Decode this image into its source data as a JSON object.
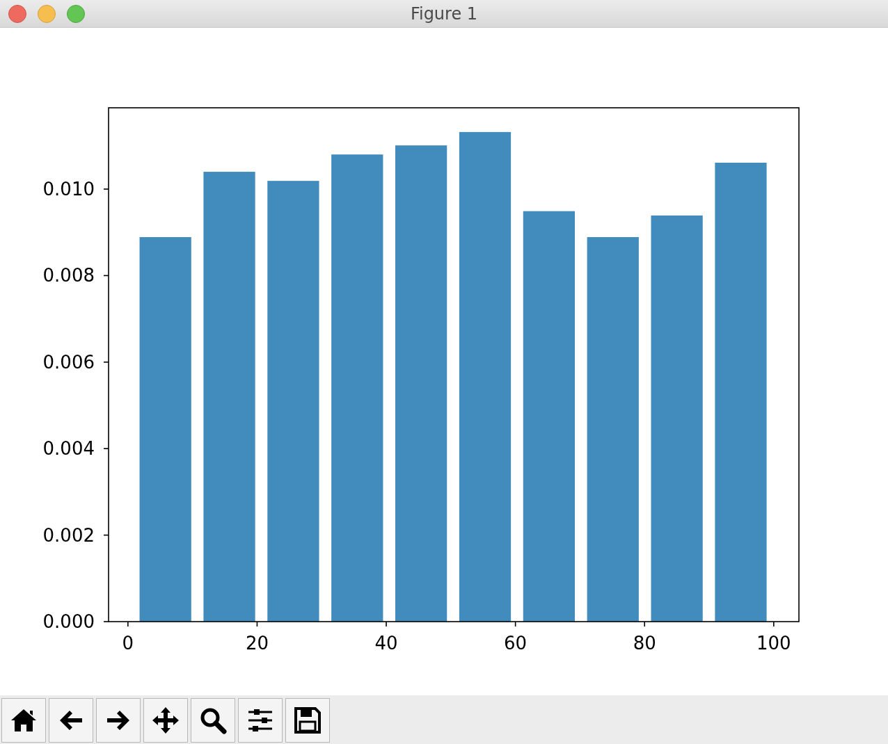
{
  "window": {
    "title": "Figure 1"
  },
  "chart_data": {
    "type": "bar",
    "x": [
      5.8,
      15.7,
      25.6,
      35.5,
      45.4,
      55.3,
      65.2,
      75.1,
      85.0,
      94.9
    ],
    "values": [
      0.00889,
      0.0104,
      0.01019,
      0.0108,
      0.01101,
      0.01132,
      0.00949,
      0.00889,
      0.00939,
      0.01061
    ],
    "xlim": [
      -3.0,
      103.9
    ],
    "ylim": [
      0,
      0.01188
    ],
    "xticks": [
      {
        "value": 0,
        "label": "0"
      },
      {
        "value": 20,
        "label": "20"
      },
      {
        "value": 40,
        "label": "40"
      },
      {
        "value": 60,
        "label": "60"
      },
      {
        "value": 80,
        "label": "80"
      },
      {
        "value": 100,
        "label": "100"
      }
    ],
    "yticks": [
      {
        "value": 0,
        "label": "0.000"
      },
      {
        "value": 0.002,
        "label": "0.002"
      },
      {
        "value": 0.004,
        "label": "0.004"
      },
      {
        "value": 0.006,
        "label": "0.006"
      },
      {
        "value": 0.008,
        "label": "0.008"
      },
      {
        "value": 0.01,
        "label": "0.010"
      }
    ]
  },
  "toolbar": [
    {
      "kind": "home"
    },
    {
      "kind": "back"
    },
    {
      "kind": "forward"
    },
    {
      "kind": "pan"
    },
    {
      "kind": "zoom"
    },
    {
      "kind": "configure"
    },
    {
      "kind": "save"
    }
  ]
}
